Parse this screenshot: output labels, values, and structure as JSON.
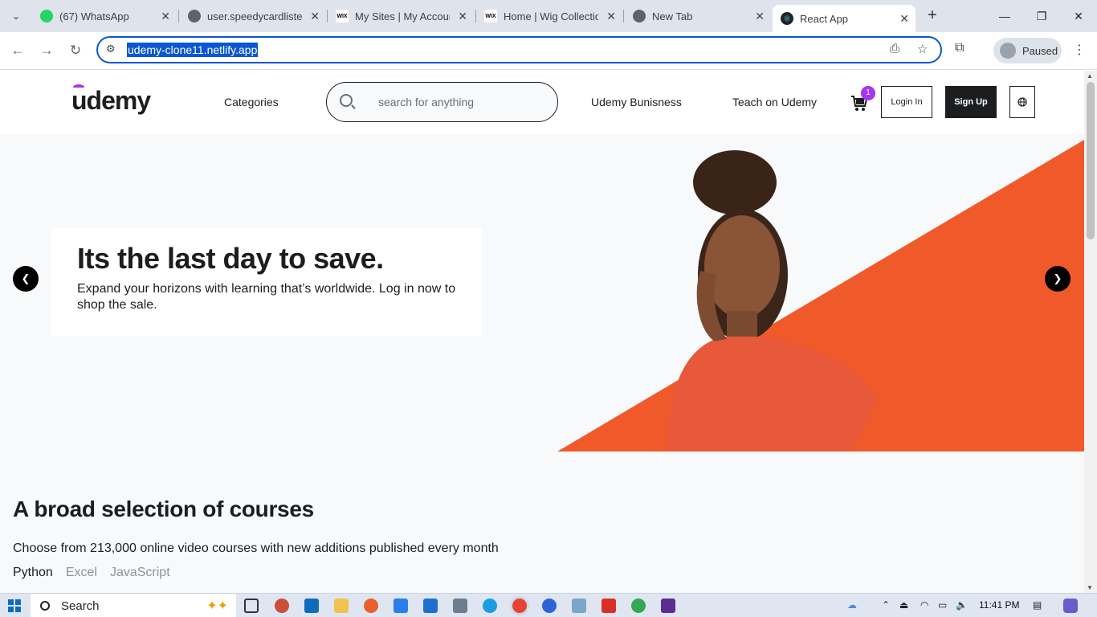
{
  "browser": {
    "tabs": [
      {
        "title": "(67) WhatsApp",
        "icon": "whatsapp-icon",
        "color": "#25d366"
      },
      {
        "title": "user.speedycardlister...",
        "icon": "globe-icon",
        "color": "#5f6368"
      },
      {
        "title": "My Sites | My Account",
        "icon": "wix-icon",
        "color": "#000000"
      },
      {
        "title": "Home | Wig Collection",
        "icon": "wix-icon",
        "color": "#000000"
      },
      {
        "title": "New Tab",
        "icon": "chrome-icon",
        "color": "#5f6368"
      },
      {
        "title": "React App",
        "icon": "react-icon",
        "color": "#20232a"
      }
    ],
    "url": "udemy-clone11.netlify.app",
    "profile_label": "Paused"
  },
  "header": {
    "logo": "udemy",
    "categories": "Categories",
    "search_placeholder": "search for anything",
    "business": "Udemy Bunisness",
    "teach": "Teach on Udemy",
    "cart_count": "1",
    "login": "Login In",
    "signup": "Sign Up"
  },
  "hero": {
    "title": "Its the last day to save.",
    "subtitle": "Expand your horizons with learning that’s worldwide. Log in now to shop the sale."
  },
  "courses": {
    "title": "A broad selection of courses",
    "subtitle": "Choose from 213,000 online video courses with new additions published every month",
    "tabs": [
      "Python",
      "Excel",
      "JavaScript"
    ]
  },
  "taskbar": {
    "search": "Search",
    "time": "11:41 PM"
  },
  "colors": {
    "accent": "#a435f0",
    "hero_orange": "#f05a2b",
    "omnibox_blue": "#0b57d0"
  }
}
